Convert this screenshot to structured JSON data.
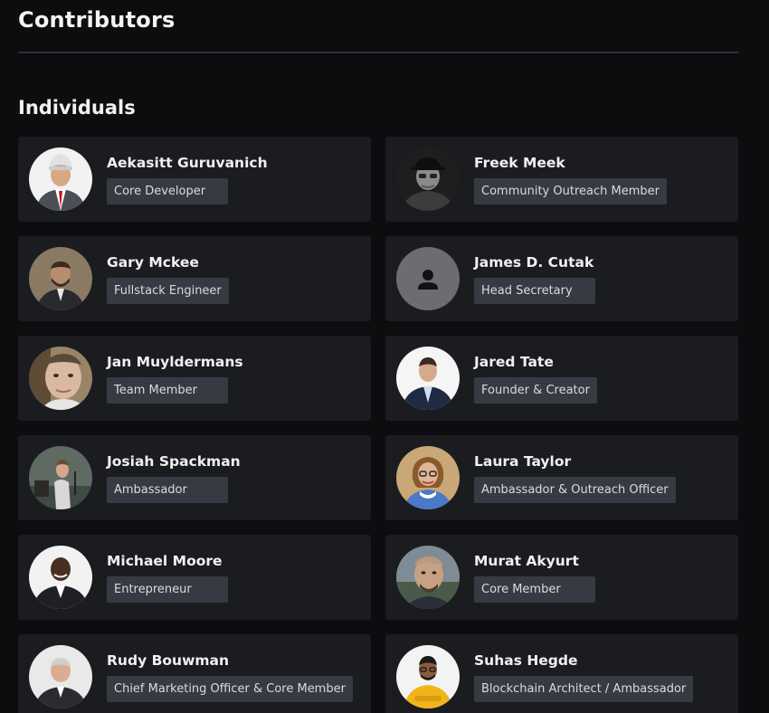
{
  "page": {
    "title": "Contributors",
    "section_title": "Individuals"
  },
  "colors": {
    "background": "#0d0d0f",
    "card": "#1b1c20",
    "badge": "#363a43",
    "divider": "#2e3036"
  },
  "contributors": [
    {
      "name": "Aekasitt Guruvanich",
      "role": "Core Developer",
      "avatar": "photo-avatar"
    },
    {
      "name": "Freek Meek",
      "role": "Community Outreach Member",
      "avatar": "photo-avatar"
    },
    {
      "name": "Gary Mckee",
      "role": "Fullstack Engineer",
      "avatar": "photo-avatar"
    },
    {
      "name": "James D. Cutak",
      "role": "Head Secretary",
      "avatar": "default-person-icon"
    },
    {
      "name": "Jan Muyldermans",
      "role": "Team Member",
      "avatar": "photo-avatar"
    },
    {
      "name": "Jared Tate",
      "role": "Founder & Creator",
      "avatar": "photo-avatar"
    },
    {
      "name": "Josiah Spackman",
      "role": "Ambassador",
      "avatar": "photo-avatar"
    },
    {
      "name": "Laura Taylor",
      "role": "Ambassador & Outreach Officer",
      "avatar": "photo-avatar"
    },
    {
      "name": "Michael Moore",
      "role": "Entrepreneur",
      "avatar": "photo-avatar"
    },
    {
      "name": "Murat Akyurt",
      "role": "Core Member",
      "avatar": "photo-avatar"
    },
    {
      "name": "Rudy Bouwman",
      "role": "Chief Marketing Officer & Core Member",
      "avatar": "photo-avatar"
    },
    {
      "name": "Suhas Hegde",
      "role": "Blockchain Architect / Ambassador",
      "avatar": "photo-avatar"
    }
  ]
}
